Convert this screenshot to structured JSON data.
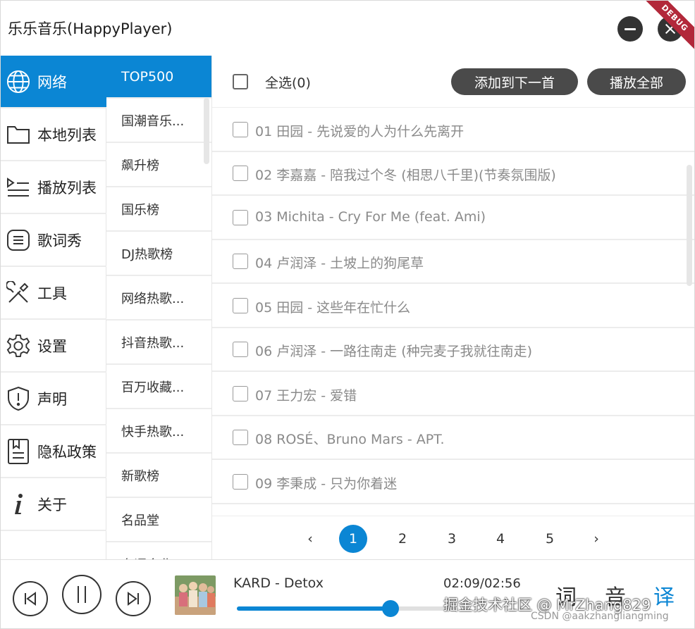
{
  "app": {
    "title": "乐乐音乐(HappyPlayer)",
    "debug_label": "DEBUG"
  },
  "nav": {
    "items": [
      {
        "label": "网络",
        "icon": "globe-icon",
        "active": true
      },
      {
        "label": "本地列表",
        "icon": "folder-icon"
      },
      {
        "label": "播放列表",
        "icon": "playlist-icon"
      },
      {
        "label": "歌词秀",
        "icon": "lyrics-icon"
      },
      {
        "label": "工具",
        "icon": "tools-icon"
      },
      {
        "label": "设置",
        "icon": "gear-icon"
      },
      {
        "label": "声明",
        "icon": "shield-icon"
      },
      {
        "label": "隐私政策",
        "icon": "policy-icon"
      },
      {
        "label": "关于",
        "icon": "info-icon"
      }
    ]
  },
  "charts": {
    "items": [
      "TOP500",
      "国潮音乐...",
      "飙升榜",
      "国乐榜",
      "DJ热歌榜",
      "网络热歌...",
      "抖音热歌...",
      "百万收藏...",
      "快手热歌...",
      "新歌榜",
      "名品堂",
      "粤语金曲"
    ]
  },
  "toolbar": {
    "select_all_label": "全选(0)",
    "add_next_label": "添加到下一首",
    "play_all_label": "播放全部"
  },
  "songs": [
    "01 田园 - 先说爱的人为什么先离开",
    "02 李嘉嘉 - 陪我过个冬 (相思八千里)(节奏氛围版)",
    "03 Michita - Cry For Me (feat. Ami)",
    "04 卢润泽 - 土坡上的狗尾草",
    "05 田园 - 这些年在忙什么",
    "06 卢润泽 - 一路往南走 (种完麦子我就往南走)",
    "07 王力宏 - 爱错",
    "08 ROSÉ、Bruno Mars - APT.",
    "09 李秉成 - 只为你着迷"
  ],
  "pager": {
    "prev": "‹",
    "next": "›",
    "pages": [
      "1",
      "2",
      "3",
      "4",
      "5"
    ],
    "current": 1
  },
  "player": {
    "song": "KARD - Detox",
    "time": "02:09/02:56",
    "progress": 0.73,
    "buttons": {
      "lyrics": "词",
      "sound": "音",
      "translate": "译"
    }
  },
  "watermark": {
    "line1": "掘金技术社区 @ MrZhang829",
    "line2": "CSDN @aakzhangliangming"
  },
  "colors": {
    "accent": "#0b86d4",
    "dark_button": "#4a4a4a"
  }
}
